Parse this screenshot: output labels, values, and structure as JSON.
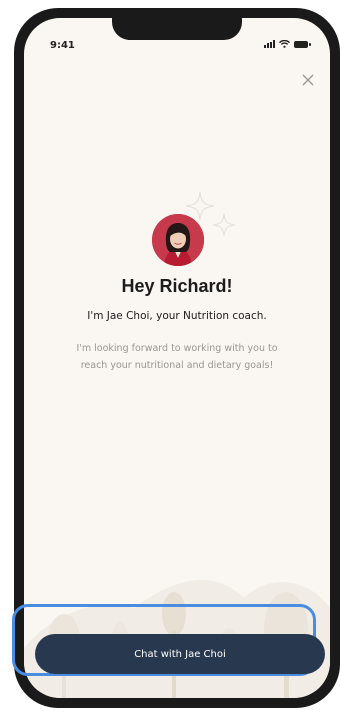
{
  "status_bar": {
    "time": "9:41"
  },
  "coach": {
    "greeting": "Hey Richard!",
    "intro": "I'm Jae Choi, your Nutrition coach.",
    "message": "I'm looking forward to working with you to reach your nutritional and dietary goals!"
  },
  "cta": {
    "label": "Chat with Jae Choi"
  },
  "colors": {
    "screen_bg": "#faf7f2",
    "button_bg": "#28384f",
    "highlight": "#4a8de0",
    "avatar_bg": "#c63a4c"
  },
  "icons": [
    "close-icon",
    "sparkle-icon",
    "signal-icon",
    "wifi-icon",
    "battery-icon"
  ]
}
